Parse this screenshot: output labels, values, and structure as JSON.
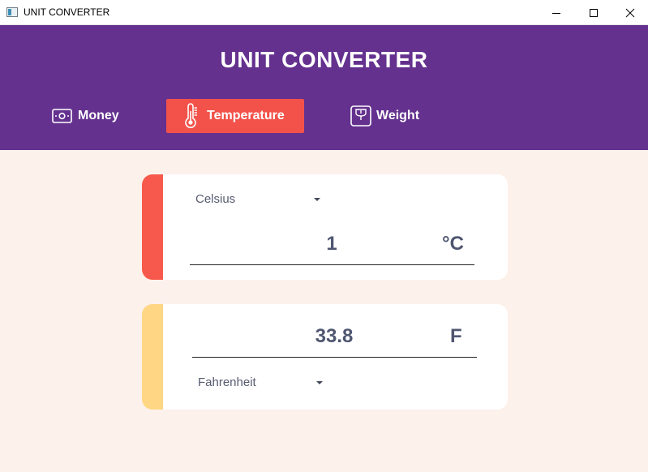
{
  "window": {
    "title": "UNIT CONVERTER",
    "icons": {
      "app": "app-window-icon",
      "minimize": "minimize-icon",
      "maximize": "maximize-icon",
      "close": "close-icon"
    }
  },
  "header": {
    "title": "UNIT CONVERTER",
    "tabs": [
      {
        "label": "Money",
        "icon": "money-icon",
        "active": false
      },
      {
        "label": "Temperature",
        "icon": "thermometer-icon",
        "active": true
      },
      {
        "label": "Weight",
        "icon": "scale-icon",
        "active": false
      }
    ]
  },
  "converter": {
    "from": {
      "unit_option": "Celsius",
      "value": "1",
      "unit_symbol": "°C"
    },
    "to": {
      "unit_option": "Fahrenheit",
      "value": "33.8",
      "unit_symbol": "F"
    }
  },
  "colors": {
    "header_bg": "#64318f",
    "active_tab": "#f2524a",
    "background": "#fdf1ec",
    "from_accent": "#f75a4c",
    "to_accent": "#ffd683",
    "text": "#4f5670"
  }
}
